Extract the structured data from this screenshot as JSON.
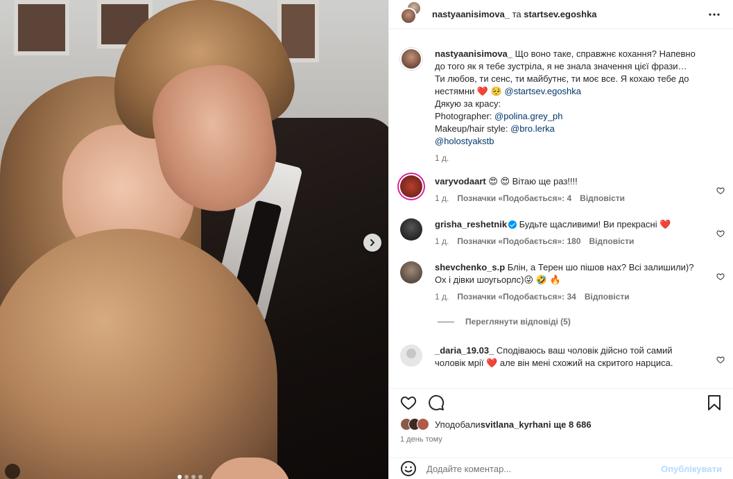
{
  "photo": {
    "alt": "",
    "carousel_dots": 4,
    "active_dot": 0
  },
  "header": {
    "user1": "nastyaanisimova_",
    "joiner": " та ",
    "user2": "startsev.egoshka"
  },
  "caption": {
    "username": "nastyaanisimova_",
    "text1": " Що воно таке, справжнє кохання? Напевно до того як я тебе зустріла, я не знала значення цієї фрази… Ти любов, ти сенс, ти майбутнє, ти моє все. Я кохаю тебе до нестямни ❤️ 🥺 ",
    "mention1": "@startsev.egoshka",
    "line_thanks": "Дякую за красу:",
    "photographer_label": "Photographer: ",
    "photographer": "@polina.grey_ph",
    "makeup_label": "Makeup/hair style: ",
    "makeup": "@bro.lerka",
    "show": "@holostyakstb",
    "time": "1 д."
  },
  "comments": [
    {
      "username": "varyvodaart",
      "text": " 😍 😍 Вітаю ще раз!!!!",
      "time": "1 д.",
      "likes": "Позначки «Подобається»: 4",
      "reply": "Відповісти"
    },
    {
      "username": "grisha_reshetnik",
      "text": " Будьте щасливими! Ви прекрасні ❤️",
      "time": "1 д.",
      "likes": "Позначки «Подобається»: 180",
      "reply": "Відповісти"
    },
    {
      "username": "shevchenko_s.p",
      "text": " Блін, а Терен шо пішов нах? Всі залишили)? Ох і дівки шоугьорлс)😜 🤣 🔥",
      "time": "1 д.",
      "likes": "Позначки «Подобається»: 34",
      "reply": "Відповісти"
    },
    {
      "username": "_daria_19.03_",
      "text": " Сподіваюсь ваш чоловік дійсно той самий чоловік мрії ❤️ але він мені схожий на скритого нарциса.",
      "time": "",
      "likes": "",
      "reply": ""
    }
  ],
  "view_replies": "Переглянути відповіді (5)",
  "likes": {
    "prefix": "Уподобали ",
    "user": "svitlana_kyrhan",
    "suffix": " і ще 8 686"
  },
  "timestamp": "1 день тому",
  "comment_input": {
    "placeholder": "Додайте коментар...",
    "post_label": "Опублікувати"
  },
  "icons": {
    "like": "heart-icon",
    "comment": "comment-icon",
    "save": "bookmark-icon",
    "more": "more-icon",
    "emoji": "emoji-icon",
    "next": "chevron-right-icon"
  },
  "colors": {
    "link": "#00376b",
    "muted": "#737373",
    "heart": "#ed4956",
    "post_disabled": "#b3dbff"
  }
}
